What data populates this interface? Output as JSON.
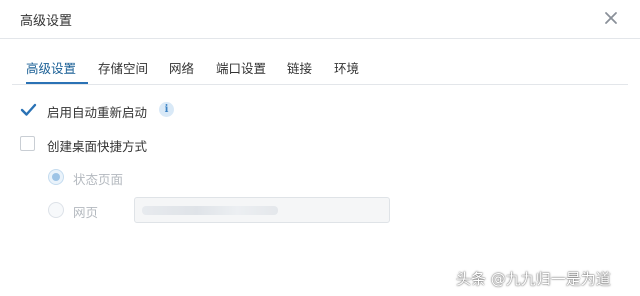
{
  "dialog": {
    "title": "高级设置",
    "close_icon": "close-icon"
  },
  "tabs": [
    {
      "label": "高级设置",
      "active": true
    },
    {
      "label": "存储空间",
      "active": false
    },
    {
      "label": "网络",
      "active": false
    },
    {
      "label": "端口设置",
      "active": false
    },
    {
      "label": "链接",
      "active": false
    },
    {
      "label": "环境",
      "active": false
    }
  ],
  "options": {
    "auto_restart": {
      "label": "启用自动重新启动",
      "checked": true,
      "info_icon": "info-icon",
      "info_glyph": "i"
    },
    "desktop_shortcut": {
      "label": "创建桌面快捷方式",
      "checked": false
    }
  },
  "shortcut_target": {
    "status_page": {
      "label": "状态页面",
      "selected": true,
      "disabled": true
    },
    "web_page": {
      "label": "网页",
      "selected": false,
      "disabled": true,
      "value": ""
    }
  },
  "watermark": "头条 @九九归一是为道",
  "colors": {
    "accent": "#2a72b5",
    "active_tab_text": "#1a5f95",
    "disabled_text": "#b4b9bf"
  }
}
